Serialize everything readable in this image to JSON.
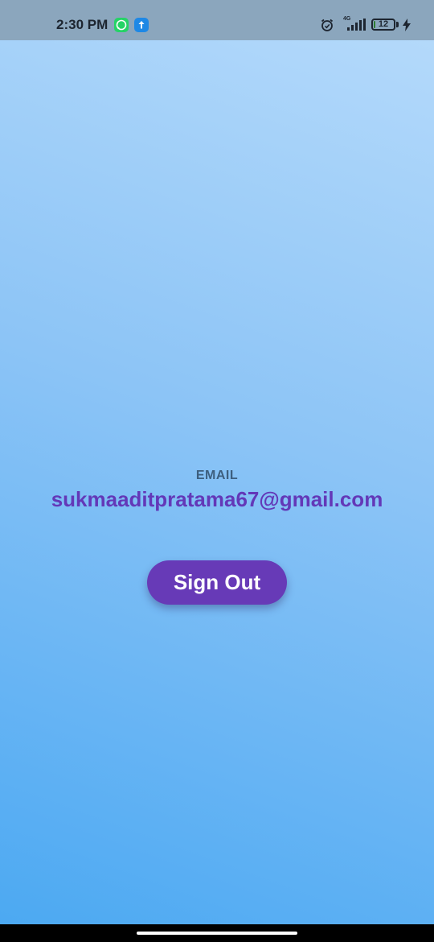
{
  "status_bar": {
    "time": "2:30 PM",
    "network": "4G",
    "battery_level": "12",
    "icons": [
      "whatsapp-icon",
      "upload-icon",
      "alarm-icon",
      "signal-icon",
      "battery-icon",
      "charging-icon"
    ]
  },
  "profile": {
    "email_label": "EMAIL",
    "email": "sukmaaditpratama67@gmail.com"
  },
  "actions": {
    "sign_out_label": "Sign Out"
  },
  "colors": {
    "accent": "#673ab7",
    "email_text": "#6338b8",
    "label_text": "#3d5f7f",
    "background_top": "#b7dbfb",
    "background_bottom": "#4aa8f2"
  }
}
